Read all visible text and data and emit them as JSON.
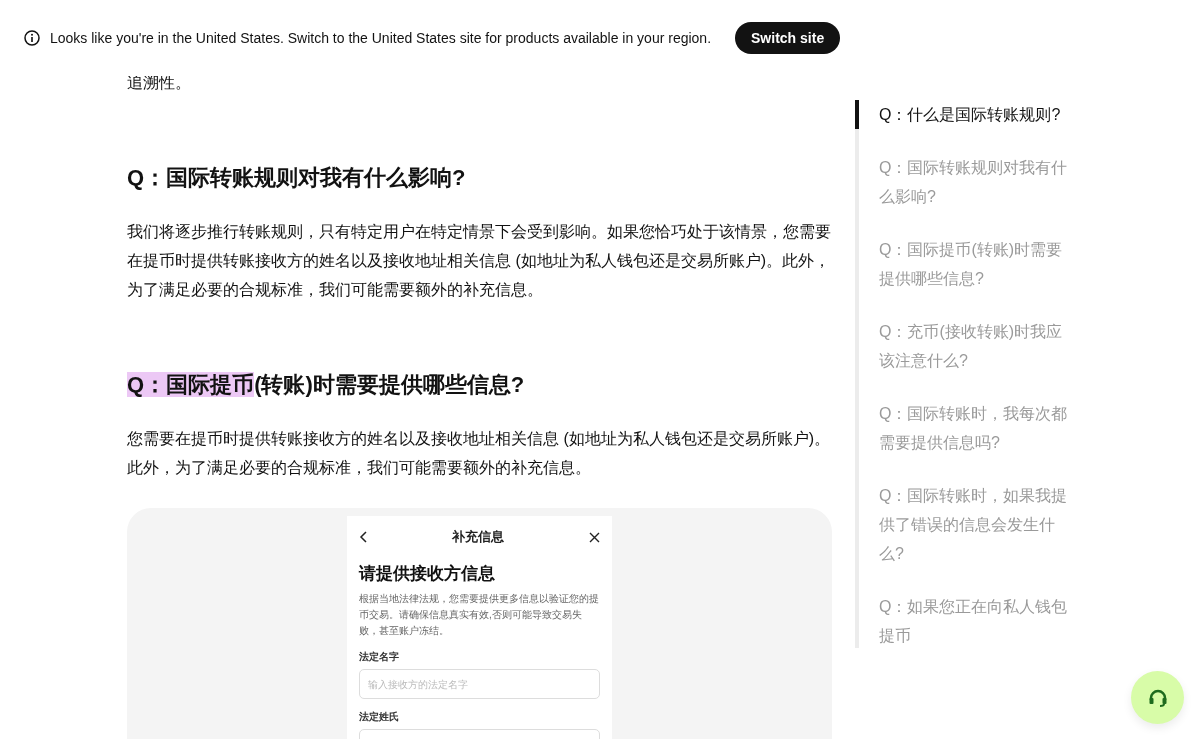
{
  "banner": {
    "message": "Looks like you're in the United States. Switch to the United States site for products available in your region.",
    "button": "Switch site"
  },
  "article": {
    "lead_tail": "追溯性。",
    "sections": [
      {
        "heading": "Q：国际转账规则对我有什么影响?",
        "body": "我们将逐步推行转账规则，只有特定用户在特定情景下会受到影响。如果您恰巧处于该情景，您需要在提币时提供转账接收方的姓名以及接收地址相关信息 (如地址为私人钱包还是交易所账户)。此外，为了满足必要的合规标准，我们可能需要额外的补充信息。"
      },
      {
        "heading_highlight": "Q：国际提币",
        "heading": "(转账)时需要提供哪些信息?",
        "body": "您需要在提币时提供转账接收方的姓名以及接收地址相关信息 (如地址为私人钱包还是交易所账户)。此外，为了满足必要的合规标准，我们可能需要额外的补充信息。"
      }
    ],
    "screenshot": {
      "nav_title": "补充信息",
      "title": "请提供接收方信息",
      "description": "根据当地法律法规，您需要提供更多信息以验证您的提币交易。请确保信息真实有效,否则可能导致交易失败，甚至账户冻结。",
      "fields": [
        {
          "label": "法定名字",
          "placeholder": "输入接收方的法定名字"
        },
        {
          "label": "法定姓氏"
        }
      ]
    }
  },
  "toc": [
    {
      "label": "Q：什么是国际转账规则?",
      "selected": true
    },
    {
      "label": "Q：国际转账规则对我有什么影响?",
      "selected": false
    },
    {
      "label": "Q：国际提币(转账)时需要提供哪些信息?",
      "selected": false
    },
    {
      "label": "Q：充币(接收转账)时我应该注意什么?",
      "selected": false
    },
    {
      "label": "Q：国际转账时，我每次都需要提供信息吗?",
      "selected": false
    },
    {
      "label": "Q：国际转账时，如果我提供了错误的信息会发生什么?",
      "selected": false
    },
    {
      "label": "Q：如果您正在向私人钱包提币",
      "selected": false
    }
  ]
}
